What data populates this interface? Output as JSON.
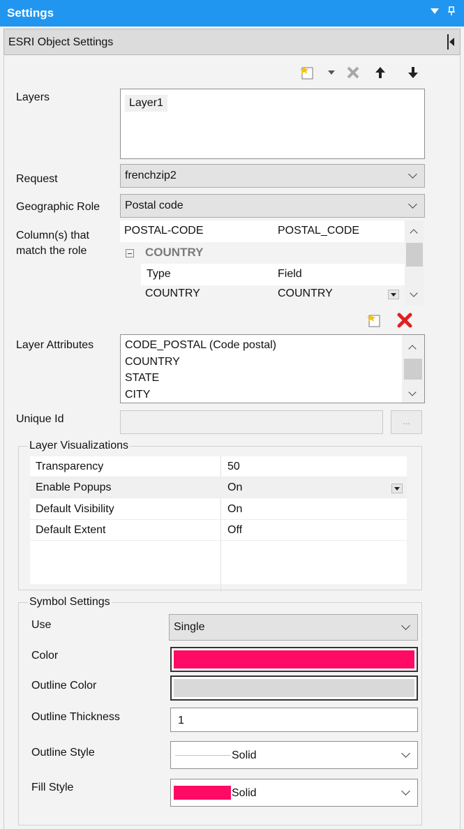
{
  "titlebar": {
    "title": "Settings"
  },
  "subbar": {
    "title": "ESRI Object Settings"
  },
  "layers": {
    "label": "Layers",
    "items": [
      "Layer1"
    ]
  },
  "request": {
    "label": "Request",
    "value": "frenchzip2"
  },
  "geo_role": {
    "label": "Geographic Role",
    "value": "Postal code"
  },
  "columns": {
    "label": "Column(s) that match the role",
    "rows": [
      {
        "left": "POSTAL-CODE",
        "right": "POSTAL_CODE"
      },
      {
        "group": "COUNTRY"
      },
      {
        "left": "Type",
        "right": "Field"
      },
      {
        "left": "COUNTRY",
        "right": "COUNTRY"
      }
    ]
  },
  "layer_attributes": {
    "label": "Layer Attributes",
    "items": [
      "CODE_POSTAL (Code postal)",
      "COUNTRY",
      "STATE",
      "CITY"
    ]
  },
  "unique_id": {
    "label": "Unique Id",
    "value": "",
    "browse_label": "..."
  },
  "visualizations": {
    "title": "Layer Visualizations",
    "rows": [
      {
        "key": "Transparency",
        "value": "50"
      },
      {
        "key": "Enable Popups",
        "value": "On"
      },
      {
        "key": "Default Visibility",
        "value": "On"
      },
      {
        "key": "Default Extent",
        "value": "Off"
      }
    ]
  },
  "symbol": {
    "title": "Symbol Settings",
    "use": {
      "label": "Use",
      "value": "Single"
    },
    "color": {
      "label": "Color",
      "hex": "#ff0a64"
    },
    "outline_color": {
      "label": "Outline Color",
      "hex": "#d9d9d9"
    },
    "outline_thickness": {
      "label": "Outline Thickness",
      "value": "1"
    },
    "outline_style": {
      "label": "Outline Style",
      "value": "Solid"
    },
    "fill_style": {
      "label": "Fill Style",
      "value": "Solid",
      "swatch_hex": "#ff0a64"
    }
  },
  "colors": {
    "titlebar": "#2196f0",
    "accent_red": "#e02020"
  }
}
